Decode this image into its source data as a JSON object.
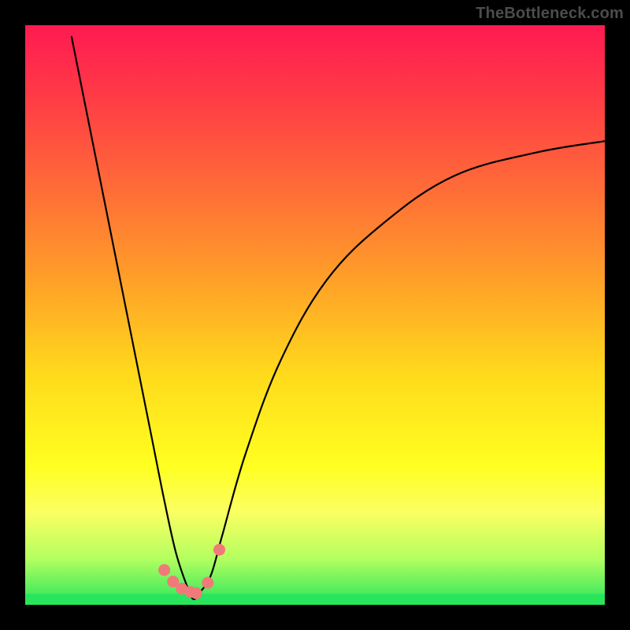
{
  "watermark": "TheBottleneck.com",
  "chart_data": {
    "type": "line",
    "title": "",
    "xlabel": "",
    "ylabel": "",
    "xlim": [
      0,
      100
    ],
    "ylim": [
      0,
      100
    ],
    "series": [
      {
        "name": "bottleneck-curve",
        "x": [
          8,
          10,
          12,
          14,
          16,
          18,
          20,
          22,
          24,
          26,
          28,
          29,
          30,
          32,
          34,
          38,
          44,
          52,
          62,
          74,
          88,
          100
        ],
        "values": [
          98,
          88,
          78,
          68,
          58,
          48,
          38,
          28,
          18,
          9,
          3,
          1,
          2,
          5,
          12,
          26,
          42,
          56,
          66,
          74,
          78,
          80
        ]
      }
    ],
    "markers": {
      "name": "highlight-dots",
      "x": [
        24.0,
        25.5,
        27.0,
        28.5,
        29.5,
        31.5,
        33.5
      ],
      "values": [
        6.0,
        4.0,
        2.8,
        2.2,
        2.0,
        3.8,
        9.5
      ]
    },
    "gradient_bands": [
      {
        "color": "#ff1a52",
        "stop": 0
      },
      {
        "color": "#ff3a46",
        "stop": 12
      },
      {
        "color": "#ff6b38",
        "stop": 28
      },
      {
        "color": "#ffa028",
        "stop": 44
      },
      {
        "color": "#ffd91c",
        "stop": 60
      },
      {
        "color": "#ffff20",
        "stop": 76
      },
      {
        "color": "#fbff62",
        "stop": 84
      },
      {
        "color": "#b4ff60",
        "stop": 92
      },
      {
        "color": "#28e55c",
        "stop": 100
      }
    ]
  }
}
